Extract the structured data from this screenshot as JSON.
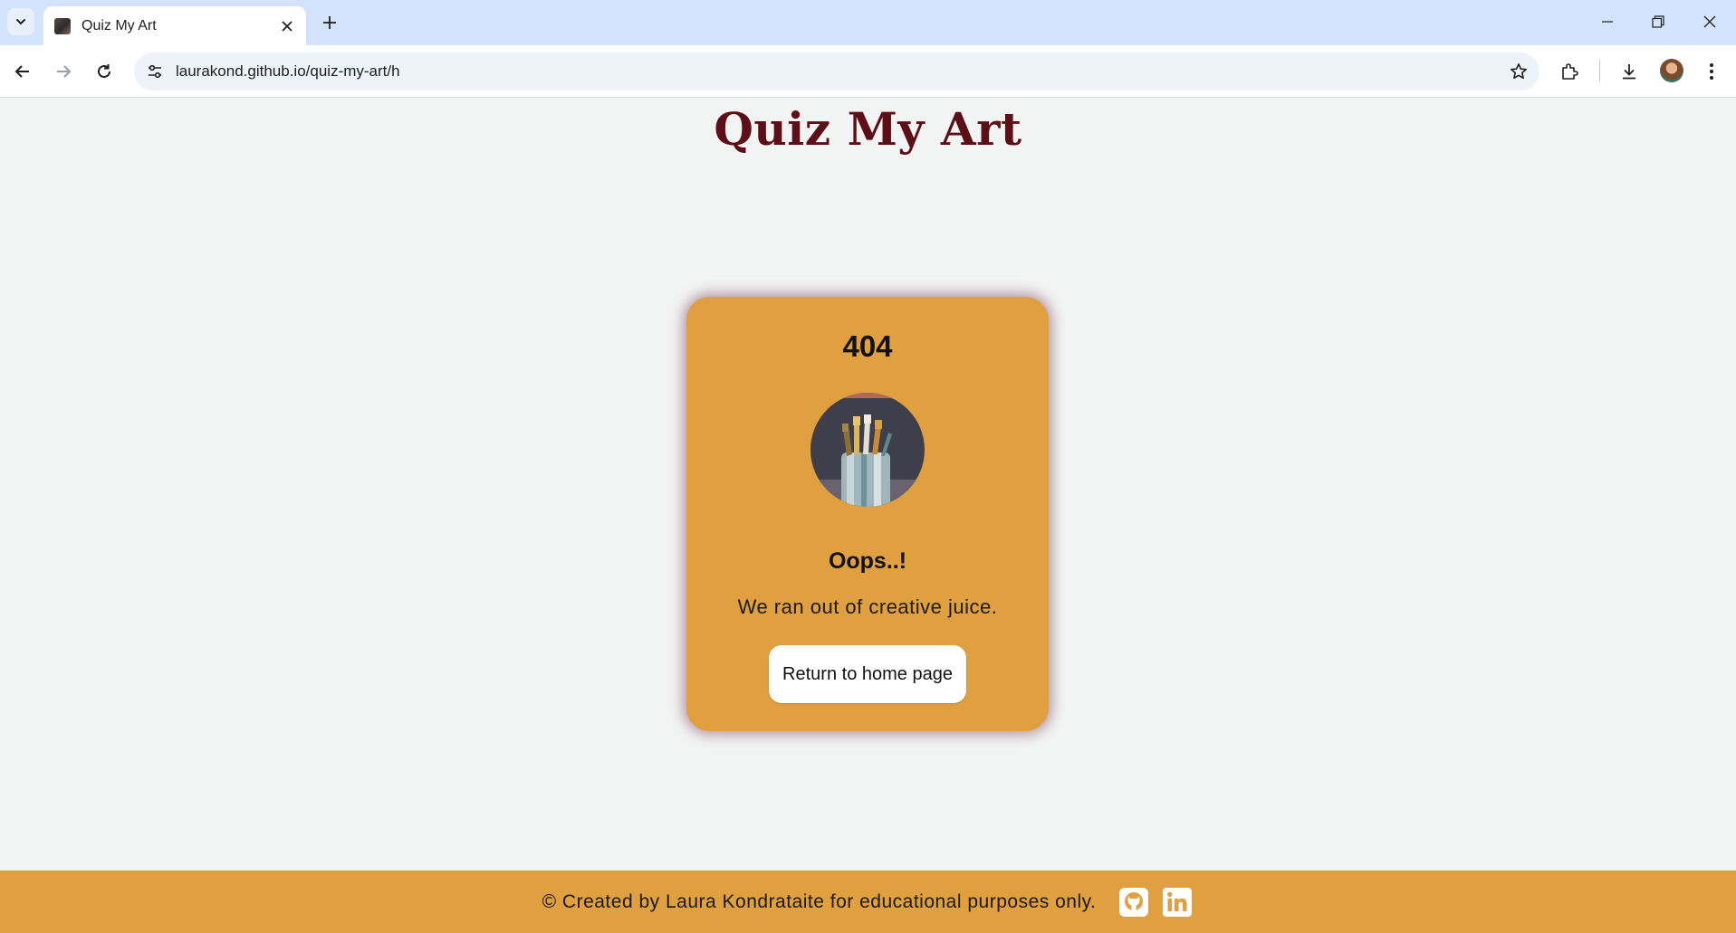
{
  "browser": {
    "tab_title": "Quiz My Art",
    "url": "laurakond.github.io/quiz-my-art/h"
  },
  "page": {
    "site_title": "Quiz My Art",
    "card": {
      "code": "404",
      "heading": "Oops..!",
      "message": "We ran out of creative juice.",
      "button_label": "Return to home page"
    },
    "footer": {
      "text": "© Created by Laura Kondrataite for educational purposes only.",
      "social_icons": [
        "github-icon",
        "linkedin-icon"
      ]
    }
  },
  "colors": {
    "accent": "#e0a03f",
    "title": "#5c0f16",
    "page_bg": "#f2f4f3",
    "tabbar_bg": "#d3e3fd"
  }
}
